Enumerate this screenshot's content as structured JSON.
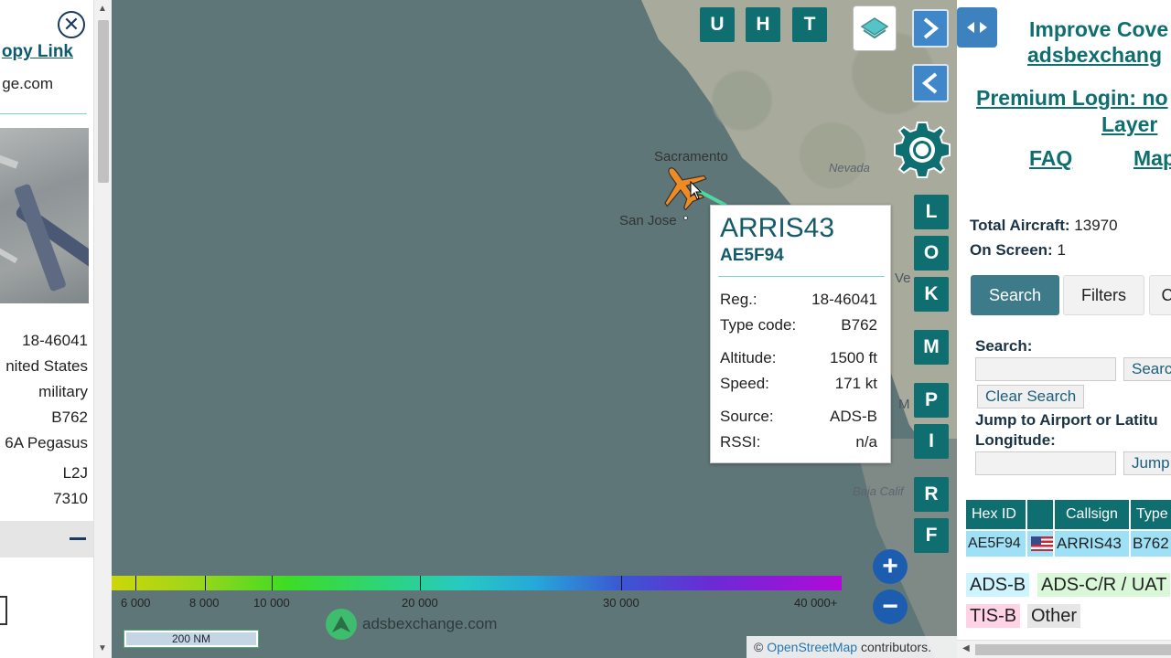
{
  "left_panel": {
    "copy_link": "opy Link",
    "site": "ge.com",
    "details": [
      "18-46041",
      "nited States",
      "military",
      "B762",
      "6A Pegasus",
      "L2J",
      "7310"
    ]
  },
  "map": {
    "labels": {
      "sacramento": "Sacramento",
      "san_jose": "San Jose",
      "nevada": "Nevada",
      "baja": "Baja Calif",
      "vegas_fragment": "Ve",
      "m_fragment": "M"
    },
    "top_buttons": [
      "U",
      "H",
      "T"
    ],
    "side_buttons": [
      "L",
      "O",
      "K",
      "M",
      "P",
      "I",
      "R",
      "F"
    ],
    "popup": {
      "callsign": "ARRIS43",
      "hex": "AE5F94",
      "rows": [
        {
          "label": "Reg.:",
          "value": "18-46041"
        },
        {
          "label": "Type code:",
          "value": "B762"
        },
        {
          "label": "Altitude:",
          "value": "1500 ft"
        },
        {
          "label": "Speed:",
          "value": "171 kt"
        },
        {
          "label": "Source:",
          "value": "ADS-B"
        },
        {
          "label": "RSSI:",
          "value": "n/a"
        }
      ]
    },
    "legend": [
      "6 000",
      "8 000",
      "10 000",
      "20 000",
      "30 000",
      "40 000+"
    ],
    "scale": "200 NM",
    "brand": "adsbexchange.com",
    "attribution": {
      "copy": "©",
      "osm": "OpenStreetMap",
      "rest": "contributors."
    },
    "colors": {
      "water": "#5f7678",
      "button": "#0e6e70",
      "nav": "#3f87c9",
      "aircraft": "#f08a24"
    }
  },
  "right_panel": {
    "improve_line1": "Improve Cove",
    "improve_line2": "adsbexchang",
    "premium_line1": "Premium Login: no",
    "premium_line2": "Layer",
    "faq": "FAQ",
    "map_link": "Map",
    "total_aircraft_label": "Total Aircraft:",
    "total_aircraft_value": "13970",
    "on_screen_label": "On Screen:",
    "on_screen_value": "1",
    "tabs": [
      "Search",
      "Filters",
      "C"
    ],
    "search_label": "Search:",
    "search_button": "Searc",
    "clear_search": "Clear Search",
    "jump_label_1": "Jump to Airport or Latitu",
    "jump_label_2": "Longitude:",
    "jump_button": "Jump",
    "table_headers": [
      "Hex ID",
      "",
      "Callsign",
      "Type"
    ],
    "table_row": {
      "hex": "AE5F94",
      "flag": "us-flag",
      "callsign": "ARRIS43",
      "type": "B762"
    },
    "source_legend": [
      {
        "label": "ADS-B",
        "color": "#cdf4ff"
      },
      {
        "label": "ADS-C/R / UAT",
        "color": "#d8f8d8"
      },
      {
        "label": "TIS-B",
        "color": "#ffd3e3"
      },
      {
        "label": "Other",
        "color": "#e6e6e6"
      }
    ]
  }
}
